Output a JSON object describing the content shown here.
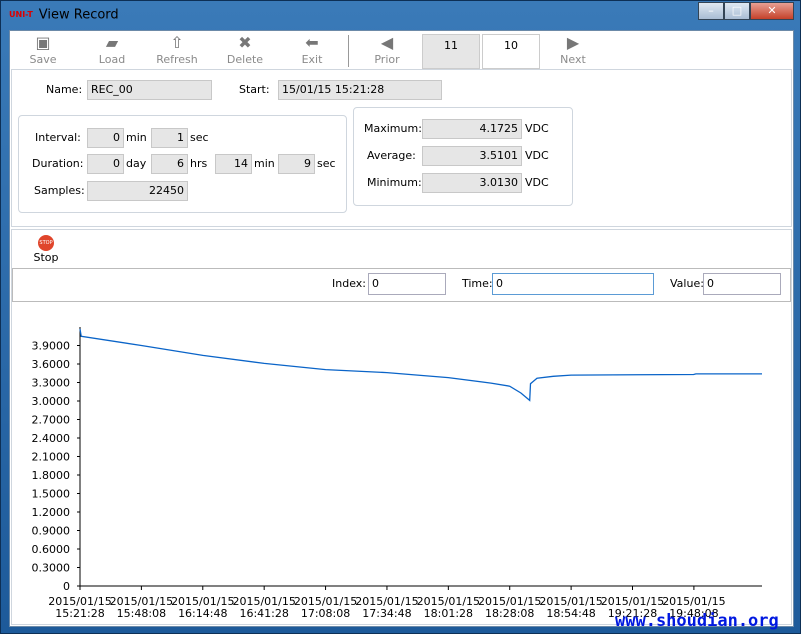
{
  "window": {
    "title": "View Record",
    "logo": "UNI-T",
    "controls": [
      "minimize",
      "maximize",
      "close"
    ]
  },
  "toolbar": {
    "items": [
      {
        "label": "Save",
        "icon": "save-icon"
      },
      {
        "label": "Load",
        "icon": "load-icon"
      },
      {
        "label": "Refresh",
        "icon": "refresh-icon"
      },
      {
        "label": "Delete",
        "icon": "delete-icon"
      },
      {
        "label": "Exit",
        "icon": "exit-icon"
      },
      {
        "label": "Prior",
        "icon": "prior-icon"
      },
      {
        "label": "Next",
        "icon": "next-icon"
      }
    ],
    "record_a": "11",
    "record_b": "10"
  },
  "info": {
    "name_label": "Name:",
    "name": "REC_00",
    "start_label": "Start:",
    "start": "15/01/15 15:21:28",
    "interval_label": "Interval:",
    "interval_min": "0",
    "min_unit": "min",
    "interval_sec": "1",
    "sec_unit": "sec",
    "duration_label": "Duration:",
    "dur_day": "0",
    "day_unit": "day",
    "dur_hrs": "6",
    "hrs_unit": "hrs",
    "dur_min": "14",
    "dur_sec": "9",
    "samples_label": "Samples:",
    "samples": "22450",
    "max_label": "Maximum:",
    "max": "4.1725",
    "avg_label": "Average:",
    "avg": "3.5101",
    "min_label": "Minimum:",
    "min": "3.0130",
    "unit": "VDC"
  },
  "controls": {
    "stop_label": "Stop",
    "index_label": "Index:",
    "index": "0",
    "time_label": "Time:",
    "time": "0",
    "value_label": "Value:",
    "value": "0"
  },
  "watermark": "www.shoudian.org",
  "chart_data": {
    "type": "line",
    "ylim": [
      0,
      4.2
    ],
    "xlim": [
      "15:21:28",
      "20:17:43"
    ],
    "yticks": [
      "0",
      "0.3000",
      "0.6000",
      "0.9000",
      "1.2000",
      "1.5000",
      "1.8000",
      "2.1000",
      "2.4000",
      "2.7000",
      "3.0000",
      "3.3000",
      "3.6000",
      "3.9000"
    ],
    "xticks": [
      [
        "2015/01/15",
        "15:21:28"
      ],
      [
        "2015/01/15",
        "15:48:08"
      ],
      [
        "2015/01/15",
        "16:14:48"
      ],
      [
        "2015/01/15",
        "16:41:28"
      ],
      [
        "2015/01/15",
        "17:08:08"
      ],
      [
        "2015/01/15",
        "17:34:48"
      ],
      [
        "2015/01/15",
        "18:01:28"
      ],
      [
        "2015/01/15",
        "18:28:08"
      ],
      [
        "2015/01/15",
        "18:54:48"
      ],
      [
        "2015/01/15",
        "19:21:28"
      ],
      [
        "2015/01/15",
        "19:48:08"
      ]
    ],
    "color": "#0a64c8",
    "points": [
      [
        "15:21:28",
        4.17
      ],
      [
        "15:22:00",
        4.05
      ],
      [
        "15:48:08",
        3.9
      ],
      [
        "16:14:48",
        3.74
      ],
      [
        "16:41:28",
        3.61
      ],
      [
        "17:08:08",
        3.51
      ],
      [
        "17:34:48",
        3.46
      ],
      [
        "18:01:28",
        3.38
      ],
      [
        "18:20:00",
        3.29
      ],
      [
        "18:28:08",
        3.24
      ],
      [
        "18:33:00",
        3.13
      ],
      [
        "18:36:48",
        3.01
      ],
      [
        "18:37:10",
        3.28
      ],
      [
        "18:40:00",
        3.37
      ],
      [
        "18:47:00",
        3.4
      ],
      [
        "18:54:48",
        3.42
      ],
      [
        "19:48:00",
        3.43
      ],
      [
        "19:49:00",
        3.44
      ],
      [
        "20:17:43",
        3.44
      ]
    ]
  }
}
